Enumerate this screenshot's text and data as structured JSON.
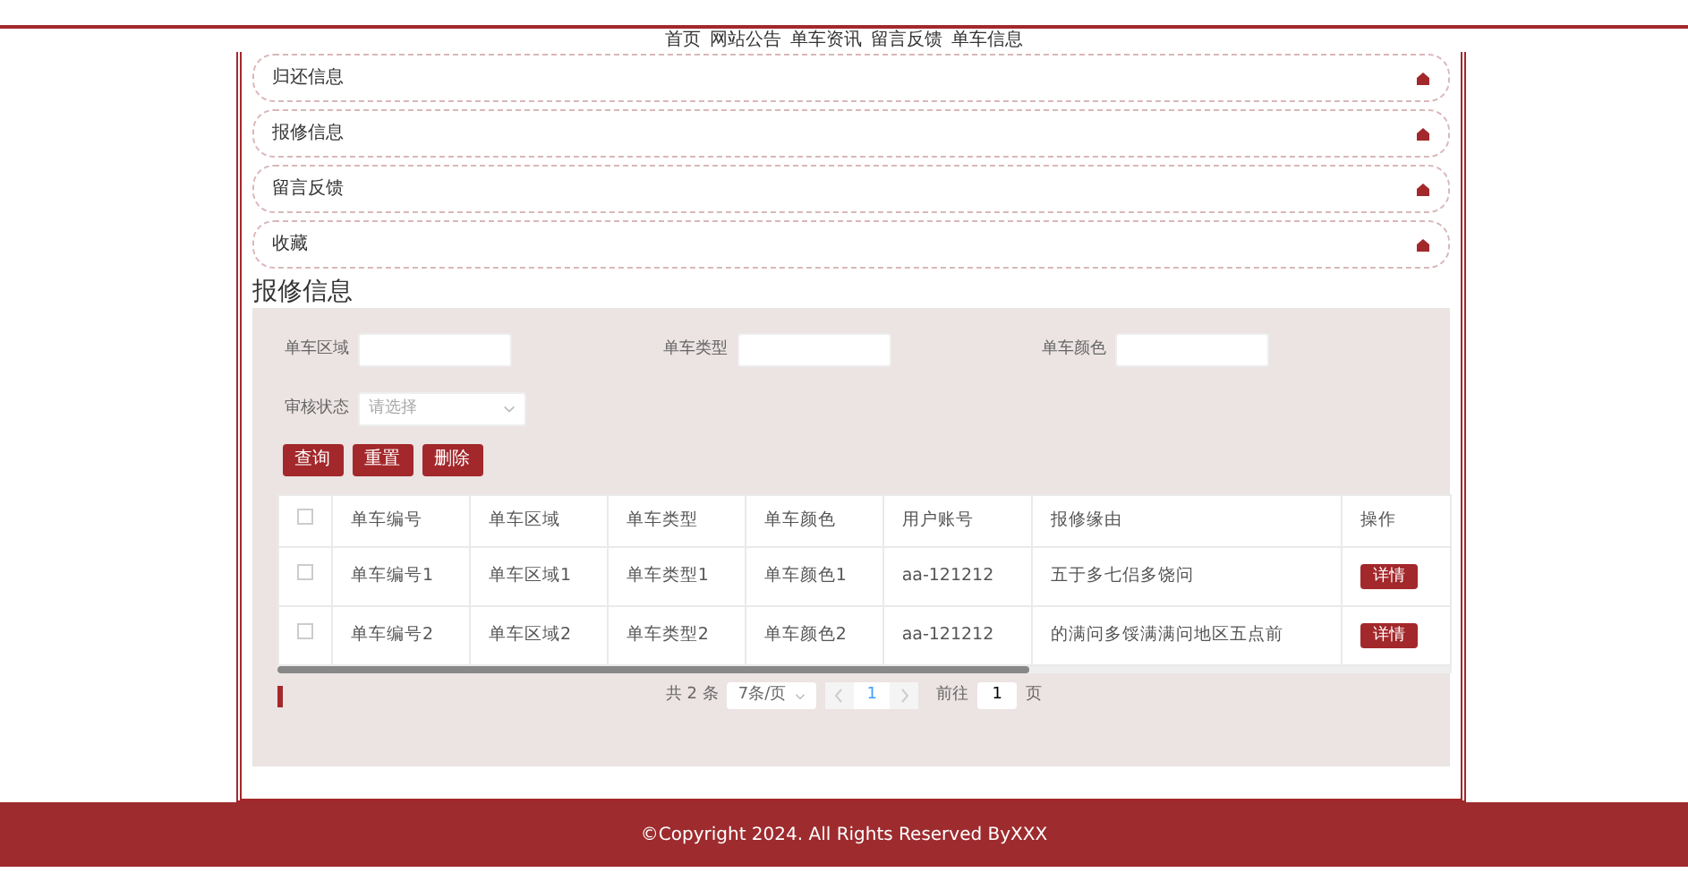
{
  "nav": [
    {
      "label": "首页"
    },
    {
      "label": "网站公告"
    },
    {
      "label": "单车资讯"
    },
    {
      "label": "留言反馈"
    },
    {
      "label": "单车信息"
    }
  ],
  "menu": [
    {
      "label": "归还信息"
    },
    {
      "label": "报修信息"
    },
    {
      "label": "留言反馈"
    },
    {
      "label": "收藏"
    }
  ],
  "section_title": "报修信息",
  "filters": [
    {
      "kind": "text",
      "label": "单车区域"
    },
    {
      "kind": "text",
      "label": "单车类型"
    },
    {
      "kind": "text",
      "label": "单车颜色"
    },
    {
      "kind": "select",
      "label": "审核状态",
      "placeholder": "请选择"
    }
  ],
  "buttons": [
    {
      "label": "查询"
    },
    {
      "label": "重置"
    },
    {
      "label": "删除"
    }
  ],
  "table": {
    "header_checked": false,
    "columns": [
      "单车编号",
      "单车区域",
      "单车类型",
      "单车颜色",
      "用户账号",
      "报修缘由",
      "操作"
    ],
    "rows": [
      {
        "checked": false,
        "cells": [
          "单车编号1",
          "单车区域1",
          "单车类型1",
          "单车颜色1",
          "aa-121212",
          "五于多七侣多饶问"
        ],
        "action": "详情"
      },
      {
        "checked": false,
        "cells": [
          "单车编号2",
          "单车区域2",
          "单车类型2",
          "单车颜色2",
          "aa-121212",
          "的满问多馁满满问地区五点前"
        ],
        "action": "详情"
      }
    ]
  },
  "pagination": {
    "total": "共 2 条",
    "page_size": "7条/页",
    "pages": [
      {
        "label": "1",
        "selected": true
      }
    ],
    "goto_label": "前往",
    "goto_value": "1",
    "goto_suffix": "页"
  },
  "footer": {
    "copyright": "©Copyright 2024. All Rights Reserved ByXXX"
  }
}
